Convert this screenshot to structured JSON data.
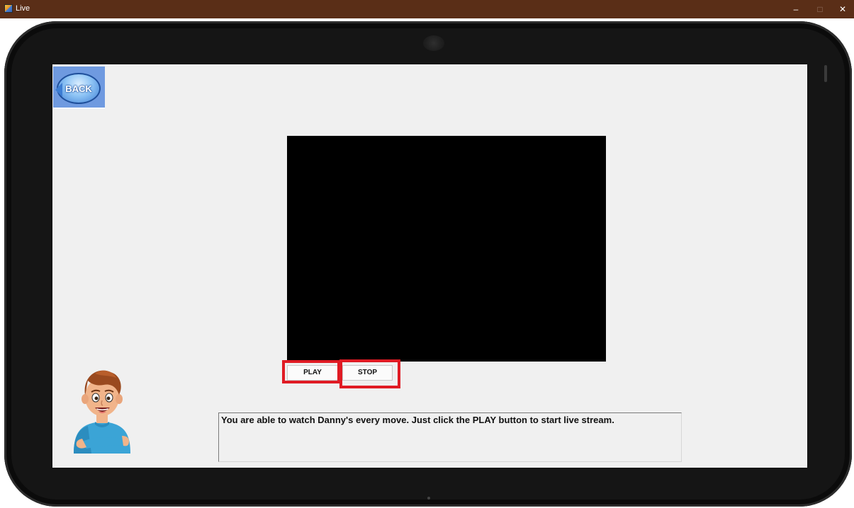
{
  "window": {
    "title": "Live",
    "minimize": "–",
    "maximize": "□",
    "close": "✕"
  },
  "back_button": {
    "label": "BACK"
  },
  "video": {
    "state": "stopped"
  },
  "controls": {
    "play_label": "PLAY",
    "stop_label": "STOP"
  },
  "message": {
    "text": "You are able to watch Danny's every move. Just click the PLAY button to start live stream."
  },
  "colors": {
    "titlebar": "#5a2e17",
    "highlight": "#e01b24",
    "screen_bg": "#f0f0f0",
    "video_bg": "#000000"
  },
  "icons": {
    "app": "app-icon",
    "back": "back-arrow-icon",
    "mascot": "character-illustration"
  }
}
